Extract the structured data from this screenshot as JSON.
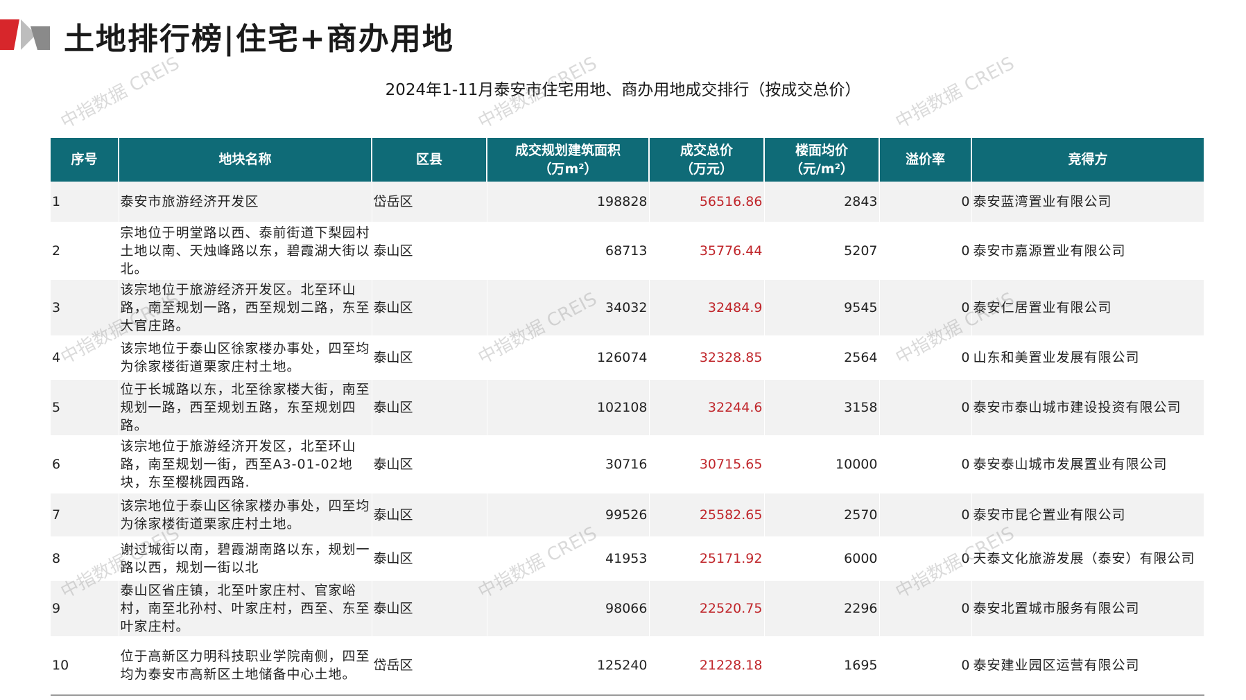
{
  "page": {
    "title": "土地排行榜|住宅+商办用地",
    "subtitle": "2024年1-11月泰安市住宅用地、商办用地成交排行（按成交总价）",
    "watermark": "中指数据 CREIS"
  },
  "colors": {
    "header_bg": "#0f6b77",
    "header_text": "#ffffff",
    "total_price_text": "#c0262b",
    "logo_red": "#d7262b",
    "logo_gray": "#8a8a8a"
  },
  "table": {
    "headers": {
      "no": "序号",
      "name": "地块名称",
      "district": "区县",
      "area_1": "成交规划建筑面积",
      "area_2": "（万m²）",
      "total_1": "成交总价",
      "total_2": "（万元）",
      "unit_1": "楼面均价",
      "unit_2": "（元/m²）",
      "premium": "溢价率",
      "buyer": "竞得方"
    },
    "rows": [
      {
        "no": "1",
        "name": "泰安市旅游经济开发区",
        "district": "岱岳区",
        "area": "198828",
        "total": "56516.86",
        "unit": "2843",
        "premium": "0",
        "buyer": "泰安蓝湾置业有限公司"
      },
      {
        "no": "2",
        "name": "宗地位于明堂路以西、泰前街道下梨园村土地以南、天烛峰路以东，碧霞湖大街以北。",
        "district": "泰山区",
        "area": "68713",
        "total": "35776.44",
        "unit": "5207",
        "premium": "0",
        "buyer": "泰安市嘉源置业有限公司"
      },
      {
        "no": "3",
        "name": "该宗地位于旅游经济开发区。北至环山路，南至规划一路，西至规划二路，东至大官庄路。",
        "district": "泰山区",
        "area": "34032",
        "total": "32484.9",
        "unit": "9545",
        "premium": "0",
        "buyer": "泰安仁居置业有限公司"
      },
      {
        "no": "4",
        "name": "该宗地位于泰山区徐家楼办事处，四至均为徐家楼街道栗家庄村土地。",
        "district": "泰山区",
        "area": "126074",
        "total": "32328.85",
        "unit": "2564",
        "premium": "0",
        "buyer": "山东和美置业发展有限公司"
      },
      {
        "no": "5",
        "name": "位于长城路以东，北至徐家楼大街，南至规划一路，西至规划五路，东至规划四路。",
        "district": "泰山区",
        "area": "102108",
        "total": "32244.6",
        "unit": "3158",
        "premium": "0",
        "buyer": "泰安市泰山城市建设投资有限公司"
      },
      {
        "no": "6",
        "name": "该宗地位于旅游经济开发区，北至环山路，南至规划一街，西至A3-01-02地块，东至樱桃园西路.",
        "district": "泰山区",
        "area": "30716",
        "total": "30715.65",
        "unit": "10000",
        "premium": "0",
        "buyer": "泰安泰山城市发展置业有限公司"
      },
      {
        "no": "7",
        "name": "该宗地位于泰山区徐家楼办事处，四至均为徐家楼街道栗家庄村土地。",
        "district": "泰山区",
        "area": "99526",
        "total": "25582.65",
        "unit": "2570",
        "premium": "0",
        "buyer": "泰安市昆仑置业有限公司"
      },
      {
        "no": "8",
        "name": "谢过城街以南，碧霞湖南路以东，规划一路以西，规划一街以北",
        "district": "泰山区",
        "area": "41953",
        "total": "25171.92",
        "unit": "6000",
        "premium": "0",
        "buyer": "天泰文化旅游发展（泰安）有限公司"
      },
      {
        "no": "9",
        "name": "泰山区省庄镇，北至叶家庄村、官家峪村，南至北孙村、叶家庄村，西至、东至叶家庄村。",
        "district": "泰山区",
        "area": "98066",
        "total": "22520.75",
        "unit": "2296",
        "premium": "0",
        "buyer": "泰安北置城市服务有限公司"
      },
      {
        "no": "10",
        "name": "位于高新区力明科技职业学院南侧，四至均为泰安市高新区土地储备中心土地。",
        "district": "岱岳区",
        "area": "125240",
        "total": "21228.18",
        "unit": "1695",
        "premium": "0",
        "buyer": "泰安建业园区运营有限公司"
      }
    ]
  }
}
